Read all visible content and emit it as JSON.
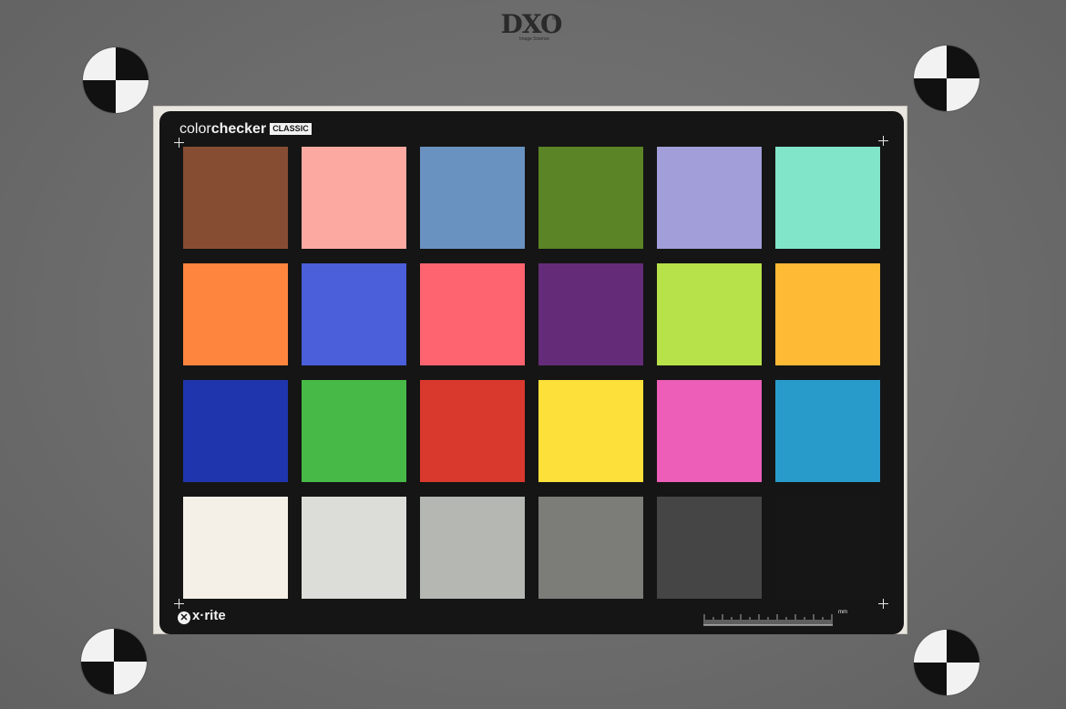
{
  "logo": {
    "text": "DXO",
    "registered": "®",
    "subtitle": "Image Science"
  },
  "card": {
    "brand_light": "color",
    "brand_bold": "checker",
    "brand_badge": "CLASSIC",
    "maker": "x·rite",
    "maker_mark": "✕",
    "ruler_unit": "mm"
  },
  "colors": {
    "background_gray": "#6e6e6e",
    "card_black": "#151515",
    "patches": [
      [
        "#874d33",
        "#fcaaa1",
        "#6a92c1",
        "#5a8426",
        "#a19ed9",
        "#80e5c9"
      ],
      [
        "#fd853d",
        "#4a5fd9",
        "#fe6470",
        "#642c78",
        "#b7e24a",
        "#feb935"
      ],
      [
        "#1f35ad",
        "#46b946",
        "#d9392d",
        "#fde039",
        "#ec5eb7",
        "#289bca"
      ],
      [
        "#f4f0e7",
        "#dcdcd8",
        "#b5b7b3",
        "#7c7c79",
        "#454545",
        "#161616"
      ]
    ]
  },
  "icons": [
    "registration-target-icon",
    "crosshair-icon",
    "ruler-scale"
  ]
}
